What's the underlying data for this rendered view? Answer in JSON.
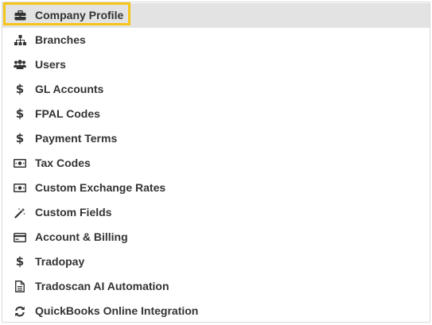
{
  "menu": {
    "items": [
      {
        "label": "Company Profile",
        "icon": "briefcase-icon",
        "active": true
      },
      {
        "label": "Branches",
        "icon": "sitemap-icon"
      },
      {
        "label": "Users",
        "icon": "users-icon"
      },
      {
        "label": "GL Accounts",
        "icon": "dollar-icon"
      },
      {
        "label": "FPAL Codes",
        "icon": "dollar-icon"
      },
      {
        "label": "Payment Terms",
        "icon": "dollar-icon"
      },
      {
        "label": "Tax Codes",
        "icon": "money-bill-icon"
      },
      {
        "label": "Custom Exchange Rates",
        "icon": "money-bill-icon"
      },
      {
        "label": "Custom Fields",
        "icon": "magic-wand-icon"
      },
      {
        "label": "Account & Billing",
        "icon": "credit-card-icon"
      },
      {
        "label": "Tradopay",
        "icon": "dollar-icon"
      },
      {
        "label": "Tradoscan AI Automation",
        "icon": "document-icon"
      },
      {
        "label": "QuickBooks Online Integration",
        "icon": "sync-icon"
      }
    ]
  },
  "colors": {
    "active_background": "#e3e3e3",
    "highlight_border": "#f5c518",
    "text": "#333333"
  }
}
